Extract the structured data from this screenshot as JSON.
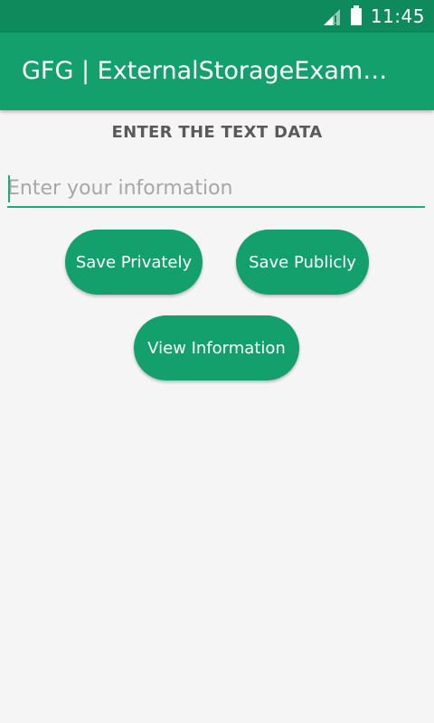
{
  "status_bar": {
    "time": "11:45",
    "icons": [
      "signal-icon",
      "battery-icon"
    ]
  },
  "app_bar": {
    "title": "GFG | ExternalStorageExampl..."
  },
  "main": {
    "heading": "ENTER THE TEXT DATA",
    "input": {
      "value": "",
      "placeholder": "Enter your information"
    },
    "buttons": {
      "save_privately": "Save Privately",
      "save_publicly": "Save Publicly",
      "view_information": "View Information"
    }
  },
  "colors": {
    "status_bar": "#0f8a5c",
    "primary": "#14a06d",
    "accent": "#18b07a",
    "background": "#f5f5f5",
    "heading_text": "#5a5a5a",
    "placeholder_text": "#a7a7a7"
  }
}
